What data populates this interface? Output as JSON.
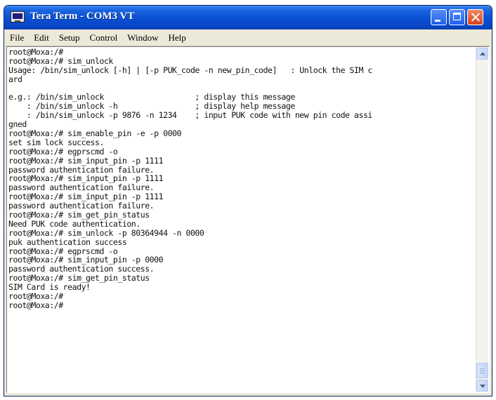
{
  "window": {
    "title": "Tera Term - COM3 VT"
  },
  "menu": [
    "File",
    "Edit",
    "Setup",
    "Control",
    "Window",
    "Help"
  ],
  "icons": {
    "app": "tera-term-icon",
    "minimize": "minimize-icon",
    "maximize": "maximize-icon",
    "close": "close-icon",
    "scroll_up": "chevron-up-icon",
    "scroll_down": "chevron-down-icon"
  },
  "terminal": {
    "lines": [
      "root@Moxa:/#",
      "root@Moxa:/# sim_unlock",
      "Usage: /bin/sim_unlock [-h] | [-p PUK_code -n new_pin_code]   : Unlock the SIM c",
      "ard",
      "",
      "e.g.: /bin/sim_unlock                    ; display this message",
      "    : /bin/sim_unlock -h                 ; display help message",
      "    : /bin/sim_unlock -p 9876 -n 1234    ; input PUK code with new pin code assi",
      "gned",
      "root@Moxa:/# sim_enable_pin -e -p 0000",
      "set sim lock success.",
      "root@Moxa:/# egprscmd -o",
      "root@Moxa:/# sim_input_pin -p 1111",
      "password authentication failure.",
      "root@Moxa:/# sim_input_pin -p 1111",
      "password authentication failure.",
      "root@Moxa:/# sim_input_pin -p 1111",
      "password authentication failure.",
      "root@Moxa:/# sim_get_pin_status",
      "Need PUK code authentication.",
      "root@Moxa:/# sim_unlock -p 80364944 -n 0000",
      "puk authentication success",
      "root@Moxa:/# egprscmd -o",
      "root@Moxa:/# sim_input_pin -p 0000",
      "password authentication success.",
      "root@Moxa:/# sim_get_pin_status",
      "SIM Card is ready!",
      "root@Moxa:/#",
      "root@Moxa:/#"
    ]
  },
  "colors": {
    "titlebar": "#0a52d6",
    "close_button": "#d8421c",
    "menubar": "#ece9d8",
    "terminal_bg": "#ffffff",
    "terminal_fg": "#111111"
  }
}
